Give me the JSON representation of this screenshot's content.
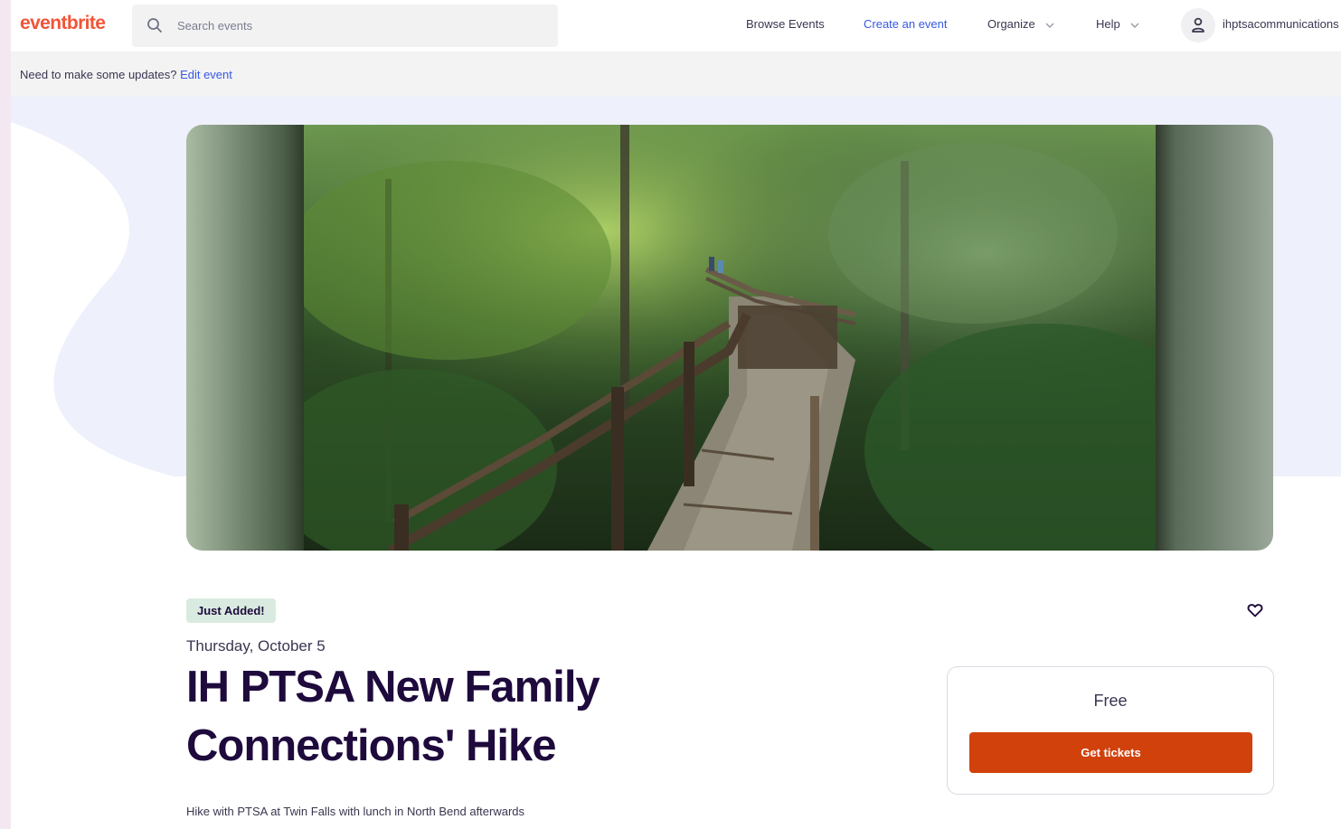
{
  "brand": {
    "logo_text": "eventbrite",
    "logo_color": "#f05537",
    "accent": "#3659e3",
    "cta_color": "#d1410c"
  },
  "search": {
    "placeholder": "Search events",
    "icon": "search-icon"
  },
  "nav": {
    "browse": "Browse Events",
    "create": "Create an event",
    "organize": "Organize",
    "help": "Help",
    "user": "ihptsacommunications"
  },
  "edit_banner": {
    "prompt": "Need to make some updates?",
    "link": "Edit event"
  },
  "event": {
    "badge": "Just Added!",
    "date": "Thursday, October 5",
    "title": "IH PTSA New Family Connections' Hike",
    "summary": "Hike with PTSA at Twin Falls with lunch in North Bend afterwards"
  },
  "ticket": {
    "price": "Free",
    "button": "Get tickets"
  }
}
